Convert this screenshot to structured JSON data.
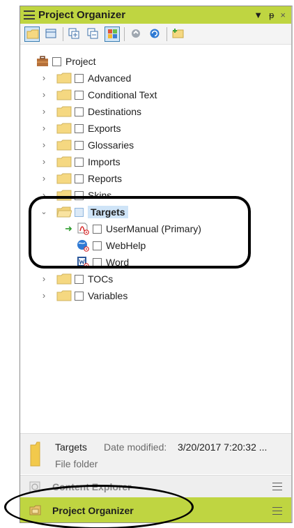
{
  "panel": {
    "title": "Project Organizer",
    "controls": [
      "▾",
      "ᵗ",
      "×"
    ]
  },
  "toolbar": {
    "buttons": [
      "folder",
      "table",
      "expand",
      "collapse",
      "grid",
      "new-globe",
      "refresh",
      "new-folder"
    ]
  },
  "tree": {
    "root": "Project",
    "items": [
      {
        "label": "Advanced",
        "expanded": false
      },
      {
        "label": "Conditional Text",
        "expanded": false
      },
      {
        "label": "Destinations",
        "expanded": false
      },
      {
        "label": "Exports",
        "expanded": false
      },
      {
        "label": "Glossaries",
        "expanded": false
      },
      {
        "label": "Imports",
        "expanded": false
      },
      {
        "label": "Reports",
        "expanded": false
      },
      {
        "label": "Skins",
        "expanded": false
      },
      {
        "label": "Targets",
        "expanded": true,
        "selected": true
      },
      {
        "label": "TOCs",
        "expanded": false
      },
      {
        "label": "Variables",
        "expanded": false
      }
    ],
    "targets": [
      {
        "label": "UserManual (Primary)",
        "icon": "pdf-target-icon",
        "primary": true
      },
      {
        "label": "WebHelp",
        "icon": "webhelp-target-icon",
        "primary": false
      },
      {
        "label": "Word",
        "icon": "word-target-icon",
        "primary": false
      }
    ]
  },
  "details": {
    "name": "Targets",
    "modified_label": "Date modified:",
    "modified_value": "3/20/2017 7:20:32 ...",
    "type": "File folder"
  },
  "bottom_tabs": {
    "content_explorer": "Content Explorer",
    "project_organizer": "Project Organizer"
  },
  "colors": {
    "accent": "#bfd541",
    "selection": "#cfe4f7",
    "folder": "#f5d881"
  }
}
